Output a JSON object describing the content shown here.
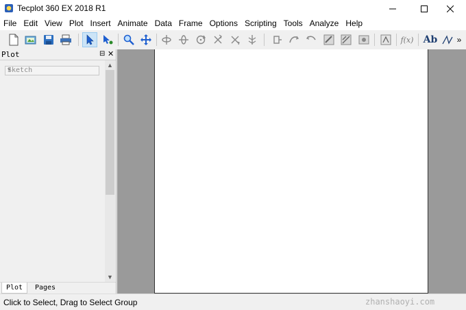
{
  "window": {
    "title": "Tecplot 360 EX 2018 R1",
    "minimize_glyph": "—",
    "maximize_glyph": "☐",
    "close_glyph": "✕"
  },
  "menu": [
    "File",
    "Edit",
    "View",
    "Plot",
    "Insert",
    "Animate",
    "Data",
    "Frame",
    "Options",
    "Scripting",
    "Tools",
    "Analyze",
    "Help"
  ],
  "toolbar": {
    "text_tool_label": "Ab",
    "function_tool_label": "f(x)",
    "overflow_glyph": "»",
    "icons": [
      "new-icon",
      "open-icon",
      "save-icon",
      "print-icon",
      "select-icon",
      "adjust-icon",
      "zoom-icon",
      "translate-icon",
      "rotate-x-icon",
      "rotate-y-icon",
      "rotate-z-icon",
      "rotate-rollerball-icon",
      "spherical-rotate-icon",
      "twist-icon",
      "probe-icon",
      "slice-icon",
      "contour-icon",
      "streamtrace-icon",
      "iso-surface-icon",
      "image-icon",
      "geometry-icon",
      "polyline-icon"
    ]
  },
  "sidebar": {
    "title": "Plot",
    "pin_glyph": "⊟",
    "close_glyph": "✕",
    "plot_type": "Sketch",
    "tabs": [
      "Plot",
      "Pages"
    ],
    "scroll_up": "▲",
    "scroll_down": "▼"
  },
  "status": {
    "text": "Click to Select, Drag to Select Group",
    "watermark": "zhanshaoyi.com"
  },
  "colors": {
    "workspace": "#9a9a9a",
    "canvas": "#ffffff",
    "select_highlight": "#cce4f7"
  }
}
